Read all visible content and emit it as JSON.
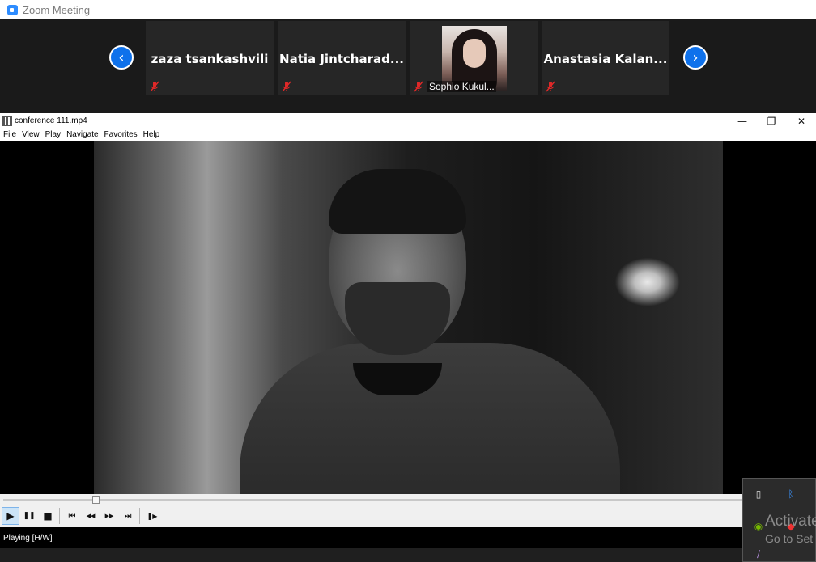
{
  "zoom": {
    "window_title": "Zoom Meeting",
    "prev_icon": "chevron-left-icon",
    "next_icon": "chevron-right-icon",
    "participants": [
      {
        "name": "zaza tsankashvili",
        "muted": true,
        "has_video": false
      },
      {
        "name": "Natia  Jintcharad...",
        "muted": true,
        "has_video": false
      },
      {
        "name": "Sophio Kukul...",
        "muted": true,
        "has_video": true
      },
      {
        "name": "Anastasia  Kalan...",
        "muted": true,
        "has_video": false
      }
    ],
    "colors": {
      "accent": "#0e71eb",
      "mute": "#e02828"
    }
  },
  "player": {
    "title": "conference 111.mp4",
    "menu": [
      "File",
      "View",
      "Play",
      "Navigate",
      "Favorites",
      "Help"
    ],
    "window_buttons": {
      "minimize": "—",
      "maximize": "❐",
      "close": "✕"
    },
    "seek_progress": 0.11,
    "controls": {
      "play": "▶",
      "pause": "❚❚",
      "stop": "■",
      "prev": "⏮",
      "rewind": "◀◀",
      "forward": "▶▶",
      "next": "⏭",
      "frame_step": "❚▶"
    },
    "status": "Playing [H/W]"
  },
  "desktop": {
    "watermark_line1": "Activate",
    "watermark_line2": "Go to Set"
  }
}
